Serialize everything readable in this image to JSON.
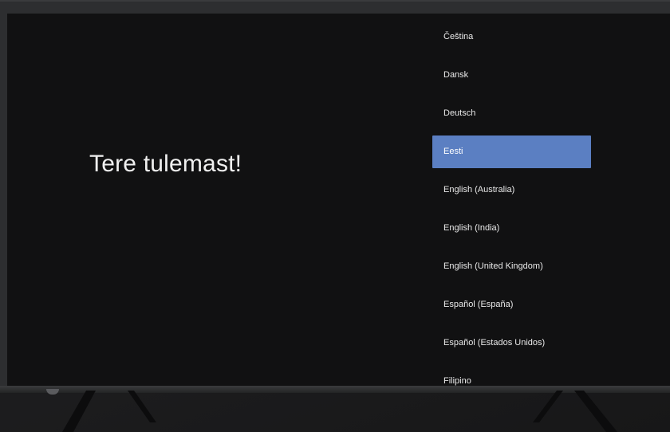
{
  "screen": {
    "welcome_text": "Tere tulemast!"
  },
  "language_list": {
    "selected_index": 3,
    "items": [
      {
        "label": "Čeština"
      },
      {
        "label": "Dansk"
      },
      {
        "label": "Deutsch"
      },
      {
        "label": "Eesti"
      },
      {
        "label": "English (Australia)"
      },
      {
        "label": "English (India)"
      },
      {
        "label": "English (United Kingdom)"
      },
      {
        "label": "Español (España)"
      },
      {
        "label": "Español (Estados Unidos)"
      },
      {
        "label": "Filipino"
      }
    ]
  },
  "colors": {
    "selection": "#5b7fc2",
    "screen_background": "#111112",
    "bezel": "#2d2e30"
  }
}
